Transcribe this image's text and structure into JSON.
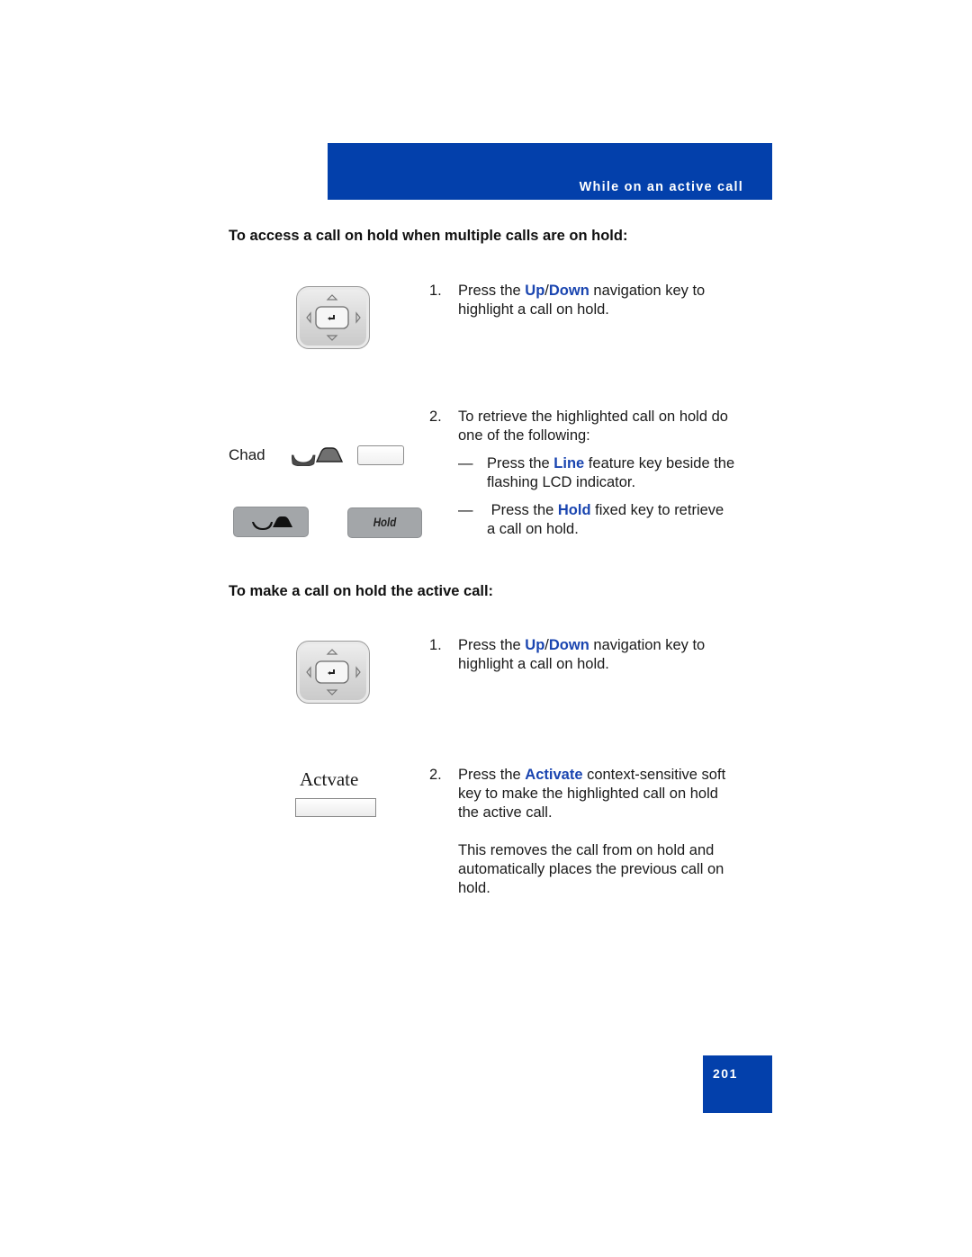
{
  "header": {
    "title": "While on an active call",
    "color": "#0340ab"
  },
  "section1": {
    "heading": "To access a call on hold when multiple calls are on hold:",
    "step1": {
      "number": "1.",
      "prefix": "Press the ",
      "key_up": "Up",
      "slash": "/",
      "key_down": "Down",
      "suffix": " navigation key to highlight a call on hold."
    },
    "step2": {
      "number": "2.",
      "text": "To retrieve the highlighted call on hold do one of the following:",
      "options": [
        {
          "dash": "—",
          "prefix": "Press the ",
          "key": "Line",
          "suffix": " feature key beside the flashing LCD indicator."
        },
        {
          "dash": "—",
          "prefix": " Press the ",
          "key": "Hold",
          "suffix": " fixed key to retrieve a call on hold."
        }
      ]
    },
    "illustrations": {
      "nav_key_icon": "navigation-key-icon",
      "line_label": "Chad",
      "line_icon": "handset-held-icon",
      "line_key_icon": "line-key-icon",
      "goodbye_key_icon": "handset-key-icon",
      "hold_key_label": "Hold"
    }
  },
  "section2": {
    "heading": "To make a call on hold the active call:",
    "step1": {
      "number": "1.",
      "prefix": "Press the ",
      "key_up": "Up",
      "slash": "/",
      "key_down": "Down",
      "suffix": " navigation key to highlight a call on hold."
    },
    "step2": {
      "number": "2.",
      "prefix": "Press the ",
      "key": "Activate",
      "suffix": " context-sensitive soft key to make the highlighted call on hold the active call.",
      "note": "This removes the call from on hold and automatically places the previous call on hold."
    },
    "illustrations": {
      "nav_key_icon": "navigation-key-icon",
      "softkey_label": "Actvate"
    }
  },
  "footer": {
    "page_number": "201"
  },
  "colors": {
    "brand_blue": "#0340ab",
    "highlight_blue": "#1a45b0"
  }
}
